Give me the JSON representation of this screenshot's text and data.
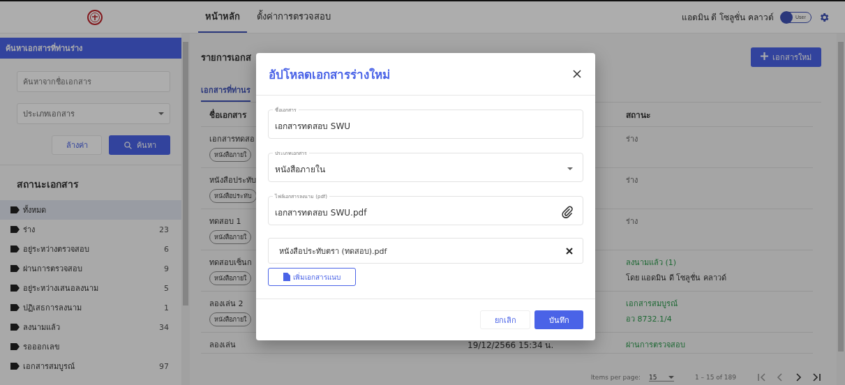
{
  "header": {
    "nav": [
      {
        "label": "หน้าหลัก",
        "selected": true
      },
      {
        "label": "ตั้งค่าการตรวจสอบ",
        "selected": false
      }
    ],
    "user_name": "แอดมิน ดี โซลูชั่น คลาวด์",
    "role_toggle": {
      "label": "User",
      "on": false
    }
  },
  "sidebar": {
    "search_title": "ค้นหาเอกสารที่ท่านร่าง",
    "search": {
      "placeholder": "ค้นหาจากชื่อเอกสาร"
    },
    "type_select": {
      "placeholder": "ประเภทเอกสาร"
    },
    "clear_button": "ล้างค่า",
    "search_button": "ค้นหา",
    "status_title": "สถานะเอกสาร",
    "items": [
      {
        "label": "ทั้งหมด",
        "selected": true
      },
      {
        "label": "ร่าง",
        "count": "23",
        "selected": false
      },
      {
        "label": "อยู่ระหว่างตรวจสอบ",
        "count": "6",
        "selected": false
      },
      {
        "label": "ผ่านการตรวจสอบ",
        "count": "9",
        "selected": false
      },
      {
        "label": "อยู่ระหว่างเสนอลงนาม",
        "count": "5",
        "selected": false
      },
      {
        "label": "ปฏิเสธการลงนาม",
        "count": "1",
        "selected": false
      },
      {
        "label": "ลงนามแล้ว",
        "count": "34",
        "selected": false
      },
      {
        "label": "รอออกเลข",
        "selected": false
      },
      {
        "label": "เอกสารสมบูรณ์",
        "count": "97",
        "selected": false
      }
    ]
  },
  "main": {
    "title": "รายการเอกส",
    "new_button": "เอกสารใหม่",
    "tabs": [
      {
        "label": "เอกสารที่ท่านร",
        "selected": true
      }
    ],
    "table": {
      "name_header": "ชื่อเอกสาร",
      "status_header": "สถานะ",
      "rows": [
        {
          "name": "เอกสารทดสอ",
          "chip": "หนังสือภายใ",
          "status": [
            {
              "text": "ร่าง",
              "kind": "plain"
            }
          ]
        },
        {
          "name": "หนังสือประทับ",
          "chip": "หนังสือประทับ",
          "status": [
            {
              "text": "ร่าง",
              "kind": "plain"
            }
          ]
        },
        {
          "name": "ทดสอบ 1",
          "chip": "หนังสือภายใ",
          "status": [
            {
              "text": "ร่าง",
              "kind": "plain"
            }
          ]
        },
        {
          "name": "ทดสอบเซ็นก",
          "chip": "หนังสือภายใ",
          "status": [
            {
              "text": "ลงนามแล้ว (1)",
              "kind": "success"
            },
            {
              "text": "โดย แอดมิน ดี โซลูชั่น คลาวด์",
              "kind": "strong"
            }
          ]
        },
        {
          "name": "ลองเล่น 2",
          "chip": "หนังสือภายใ",
          "status": [
            {
              "text": "เอกสารสมบูรณ์",
              "kind": "success"
            },
            {
              "text": "อว 8732.1/4",
              "kind": "success"
            }
          ]
        },
        {
          "name": "ลองเล่น",
          "column_2": "19/12/2566 15:34 น.",
          "status": [
            {
              "text": "ผ่านการตรวจสอบ",
              "kind": "success"
            }
          ]
        }
      ]
    },
    "paginator": {
      "label": "Items per page:",
      "page_size": "15",
      "range": "1 – 15 of 189"
    }
  },
  "dialog": {
    "title": "อัปโหลดเอกสารร่างใหม่",
    "fields": [
      {
        "kind": "text",
        "label": "ชื่อเอกสาร",
        "value": "เอกสารทดสอบ SWU"
      },
      {
        "kind": "select",
        "label": "ประเภทเอกสาร",
        "value": "หนังสือภายใน"
      },
      {
        "kind": "file",
        "label": "ไฟล์เอกสารลงนาม (pdf)",
        "value": "เอกสารทดสอบ SWU.pdf"
      }
    ],
    "attachments": [
      "หนังสือประทับตรา (ทดสอบ).pdf"
    ],
    "add_attachment_button": "เพิ่มเอกสารแนบ",
    "cancel_button": "ยกเลิก",
    "save_button": "บันทึก"
  }
}
